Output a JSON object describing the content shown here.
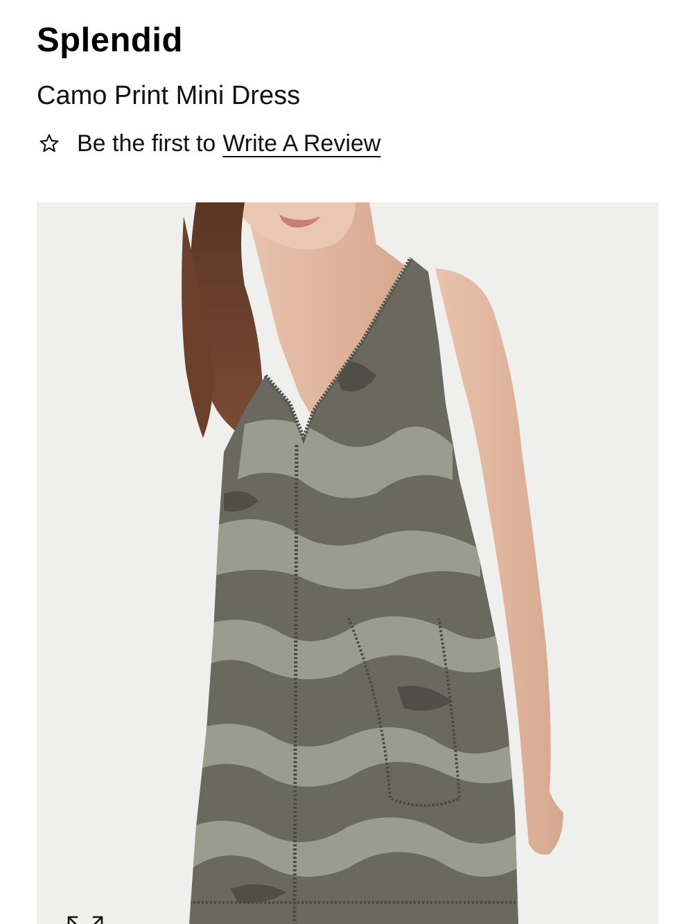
{
  "product": {
    "brand": "Splendid",
    "name": "Camo Print Mini Dress"
  },
  "reviews": {
    "prefix": "Be the first to",
    "link_label": "Write A Review",
    "icon": "star-outline-icon"
  },
  "gallery": {
    "image_description_icon": "product-photo",
    "zoom_icon": "expand-arrows-icon"
  },
  "colors": {
    "text": "#111111",
    "image_background": "#efefed",
    "camo_dark": "#5f5e56",
    "camo_light": "#9a9c8d"
  }
}
